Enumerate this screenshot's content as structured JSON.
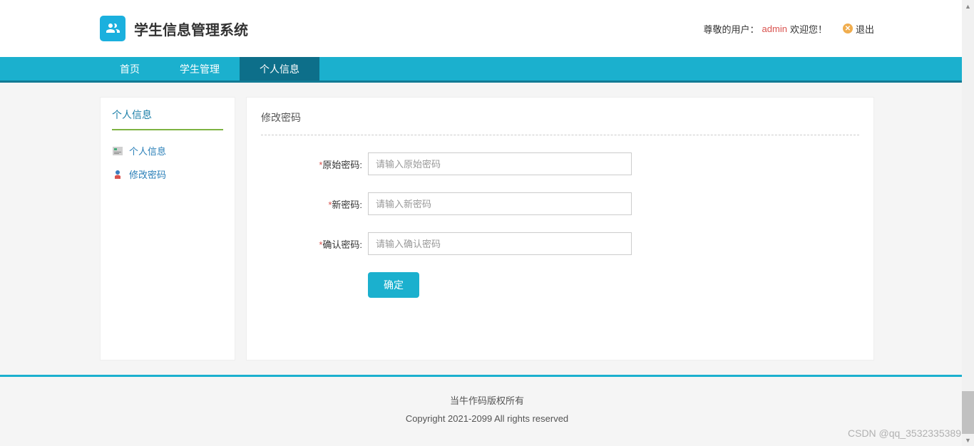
{
  "header": {
    "title": "学生信息管理系统",
    "user_prefix": "尊敬的用户：",
    "user_name": "admin",
    "user_suffix": " 欢迎您！",
    "logout_label": "退出"
  },
  "nav": {
    "items": [
      {
        "label": "首页",
        "active": false
      },
      {
        "label": "学生管理",
        "active": false
      },
      {
        "label": "个人信息",
        "active": true
      }
    ]
  },
  "sidebar": {
    "title": "个人信息",
    "items": [
      {
        "label": "个人信息"
      },
      {
        "label": "修改密码"
      }
    ]
  },
  "content": {
    "title": "修改密码",
    "form": {
      "old_password": {
        "label": "原始密码:",
        "placeholder": "请输入原始密码"
      },
      "new_password": {
        "label": "新密码:",
        "placeholder": "请输入新密码"
      },
      "confirm_password": {
        "label": "确认密码:",
        "placeholder": "请输入确认密码"
      },
      "submit_label": "确定"
    }
  },
  "footer": {
    "line1": "当牛作码版权所有",
    "line2": "Copyright 2021-2099 All rights reserved"
  },
  "watermark": "CSDN @qq_3532335389"
}
